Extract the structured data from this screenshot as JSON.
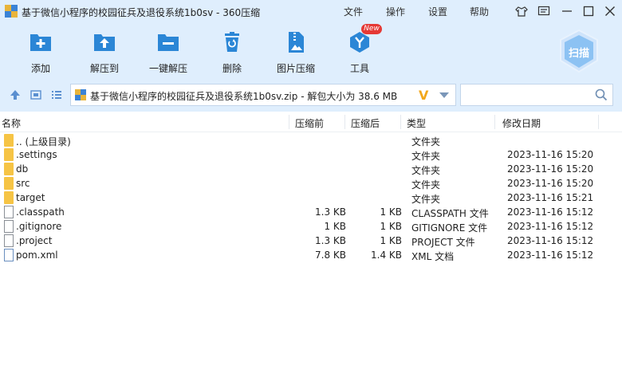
{
  "window": {
    "title": "基于微信小程序的校园征兵及退役系统1b0sv - 360压缩",
    "menus": [
      "文件",
      "操作",
      "设置",
      "帮助"
    ]
  },
  "toolbar": {
    "items": [
      {
        "label": "添加",
        "icon": "add-icon"
      },
      {
        "label": "解压到",
        "icon": "extract-to-icon"
      },
      {
        "label": "一键解压",
        "icon": "one-click-extract-icon"
      },
      {
        "label": "删除",
        "icon": "delete-icon"
      },
      {
        "label": "图片压缩",
        "icon": "image-compress-icon"
      },
      {
        "label": "工具",
        "icon": "tools-icon"
      }
    ],
    "new_badge": "New",
    "scan_label": "扫描"
  },
  "address": {
    "path": "基于微信小程序的校园征兵及退役系统1b0sv.zip - 解包大小为 38.6 MB",
    "search_value": ""
  },
  "columns": [
    "名称",
    "压缩前",
    "压缩后",
    "类型",
    "修改日期"
  ],
  "files": [
    {
      "name": ".. (上级目录)",
      "compressed": "",
      "packed": "",
      "type": "文件夹",
      "modified": "",
      "icon": "folder"
    },
    {
      "name": ".settings",
      "compressed": "",
      "packed": "",
      "type": "文件夹",
      "modified": "2023-11-16 15:20",
      "icon": "folder"
    },
    {
      "name": "db",
      "compressed": "",
      "packed": "",
      "type": "文件夹",
      "modified": "2023-11-16 15:20",
      "icon": "folder"
    },
    {
      "name": "src",
      "compressed": "",
      "packed": "",
      "type": "文件夹",
      "modified": "2023-11-16 15:20",
      "icon": "folder"
    },
    {
      "name": "target",
      "compressed": "",
      "packed": "",
      "type": "文件夹",
      "modified": "2023-11-16 15:21",
      "icon": "folder"
    },
    {
      "name": ".classpath",
      "compressed": "1.3 KB",
      "packed": "1 KB",
      "type": "CLASSPATH 文件",
      "modified": "2023-11-16 15:12",
      "icon": "file"
    },
    {
      "name": ".gitignore",
      "compressed": "1 KB",
      "packed": "1 KB",
      "type": "GITIGNORE 文件",
      "modified": "2023-11-16 15:12",
      "icon": "file"
    },
    {
      "name": ".project",
      "compressed": "1.3 KB",
      "packed": "1 KB",
      "type": "PROJECT 文件",
      "modified": "2023-11-16 15:12",
      "icon": "file"
    },
    {
      "name": "pom.xml",
      "compressed": "7.8 KB",
      "packed": "1.4 KB",
      "type": "XML 文档",
      "modified": "2023-11-16 15:12",
      "icon": "xml"
    }
  ],
  "colors": {
    "toolbar_bg": "#dfeefd",
    "accent_blue": "#2b86d6",
    "folder_yellow": "#f6c445",
    "badge_red": "#e53935"
  }
}
